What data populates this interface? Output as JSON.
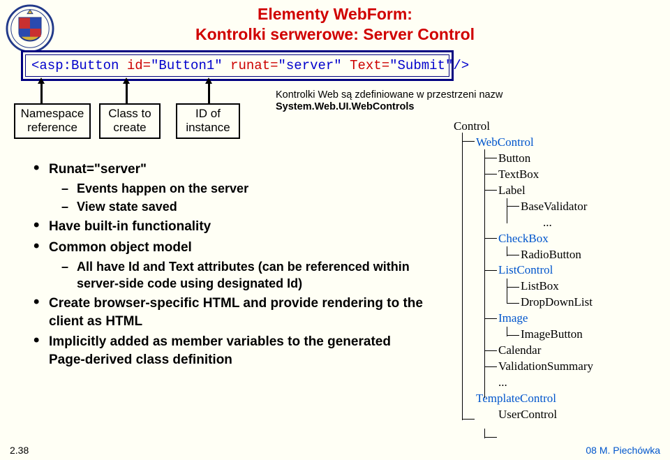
{
  "title_line1": "Elementy WebForm:",
  "title_line2": "Kontrolki serwerowe: Server Control",
  "code": {
    "open": "<asp:Button",
    "a1n": " id=",
    "a1v": "\"Button1\"",
    "a2n": " runat=",
    "a2v": "\"server\"",
    "a3n": " Text=",
    "a3v": "\"Submit\"",
    "close": "/>"
  },
  "labels": {
    "ns1": "Namespace",
    "ns2": "reference",
    "cls1": "Class to",
    "cls2": "create",
    "id1": "ID of",
    "id2": "instance"
  },
  "bul": {
    "b1": "Runat=\"server\"",
    "b1a": "Events happen on the server",
    "b1b": "View state saved",
    "b2": "Have built-in functionality",
    "b3": "Common object model",
    "b3a": "All have Id and Text attributes (can be referenced within server-side code using designated Id)",
    "b4": "Create browser-specific HTML and provide rendering to the client as HTML",
    "b5": "Implicitly added as member variables to the generated Page-derived class definition"
  },
  "rnote1": "Kontrolki Web są zdefiniowane w przestrzeni nazw",
  "rnote2": "System.Web.UI.WebControls",
  "hier": {
    "control": "Control",
    "webcontrol": "WebControl",
    "button": "Button",
    "textbox": "TextBox",
    "label": "Label",
    "basevalidator": "BaseValidator",
    "dots1": "...",
    "checkbox": "CheckBox",
    "radiobutton": "RadioButton",
    "listcontrol": "ListControl",
    "listbox": "ListBox",
    "dropdown": "DropDownList",
    "image": "Image",
    "imagebutton": "ImageButton",
    "calendar": "Calendar",
    "validationsummary": "ValidationSummary",
    "dots2": "...",
    "templatecontrol": "TemplateControl",
    "usercontrol": "UserControl"
  },
  "page_num": "2.38",
  "footer_right": "08 M. Piechówka"
}
